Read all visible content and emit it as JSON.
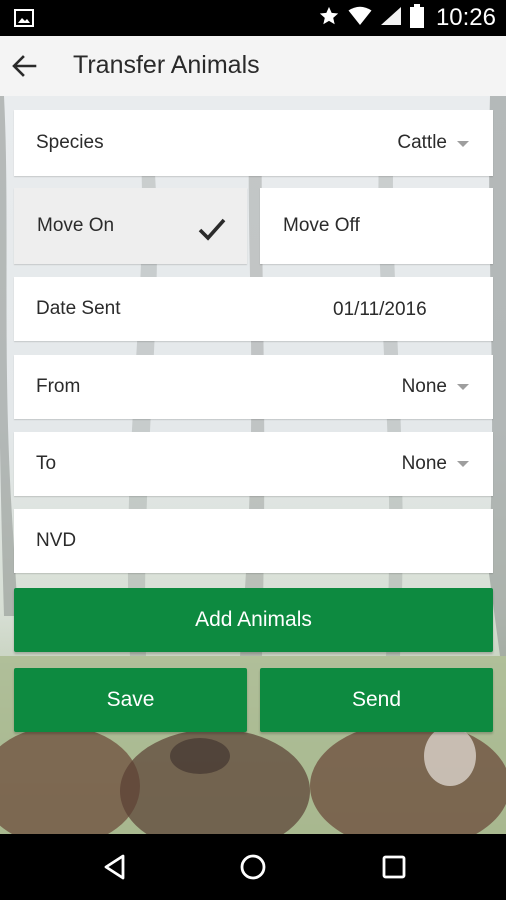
{
  "status_bar": {
    "time": "10:26"
  },
  "app_bar": {
    "title": "Transfer Animals"
  },
  "form": {
    "species": {
      "label": "Species",
      "value": "Cattle"
    },
    "movement": {
      "move_on_label": "Move On",
      "move_off_label": "Move Off",
      "selected": "Move On"
    },
    "date_sent": {
      "label": "Date Sent",
      "value": "01/11/2016"
    },
    "from": {
      "label": "From",
      "value": "None"
    },
    "to": {
      "label": "To",
      "value": "None"
    },
    "nvd": {
      "label": "NVD",
      "value": ""
    }
  },
  "buttons": {
    "add_animals": "Add Animals",
    "save": "Save",
    "send": "Send"
  },
  "colors": {
    "accent_green": "#0d8a40",
    "app_bar": "#f4f4f4"
  }
}
